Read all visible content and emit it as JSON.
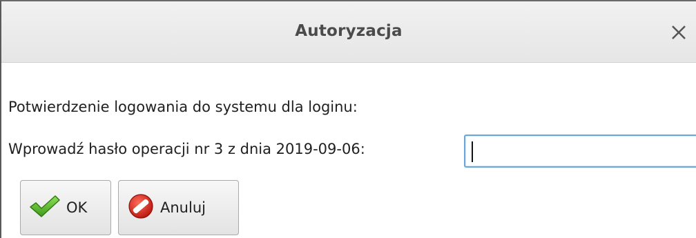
{
  "dialog": {
    "title": "Autoryzacja",
    "close_icon": "close-icon"
  },
  "content": {
    "confirm_text": "Potwierdzenie logowania do systemu dla loginu:",
    "password_label": "Wprowadź hasło operacji nr 3 z dnia 2019-09-06:",
    "password_value": ""
  },
  "buttons": {
    "ok_label": "OK",
    "ok_icon": "checkmark-icon",
    "cancel_label": "Anuluj",
    "cancel_icon": "cancel-icon"
  },
  "colors": {
    "ok_green": "#5fbf2a",
    "cancel_red": "#d9261c",
    "focus_border": "#6aa7d8"
  }
}
